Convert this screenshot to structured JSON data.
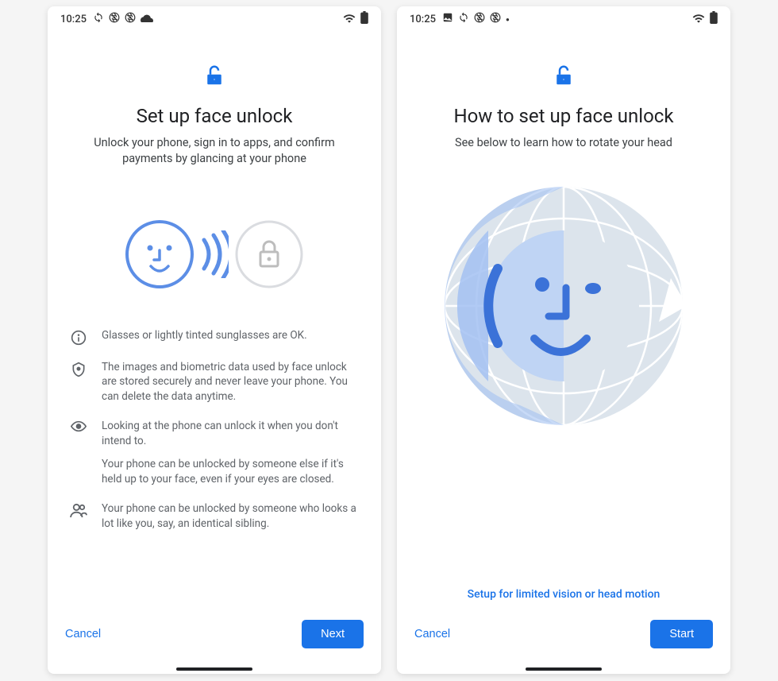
{
  "colors": {
    "primary": "#1a73e8",
    "face_blue": "#5c8ee6",
    "grey": "#5f6368",
    "light_grey": "#dadce0"
  },
  "screen1": {
    "status": {
      "time": "10:25",
      "icons": [
        "sync-arrows-icon",
        "aperture-icon",
        "aperture-icon",
        "cloud-icon"
      ],
      "right": [
        "wifi-icon",
        "battery-icon"
      ]
    },
    "title": "Set up face unlock",
    "subtitle": "Unlock your phone, sign in to apps, and confirm payments by glancing at your phone",
    "info": {
      "glasses": "Glasses or lightly tinted sunglasses are OK.",
      "security": "The images and biometric data used by face unlock are stored securely and never leave your phone. You can delete the data anytime.",
      "look_a": "Looking at the phone can unlock it when you don't intend to.",
      "look_b": "Your phone can be unlocked by someone else if it's held up to your face, even if your eyes are closed.",
      "sibling": "Your phone can be unlocked by someone who looks a lot like you, say, an identical sibling."
    },
    "footer": {
      "cancel": "Cancel",
      "next": "Next"
    }
  },
  "screen2": {
    "status": {
      "time": "10:25",
      "icons": [
        "image-icon",
        "sync-arrows-icon",
        "aperture-icon",
        "aperture-icon",
        "dot-icon"
      ],
      "right": [
        "wifi-icon",
        "battery-icon"
      ]
    },
    "title": "How to set up face unlock",
    "subtitle": "See below to learn how to rotate your head",
    "accessibility_link": "Setup for limited vision or head motion",
    "footer": {
      "cancel": "Cancel",
      "start": "Start"
    }
  }
}
